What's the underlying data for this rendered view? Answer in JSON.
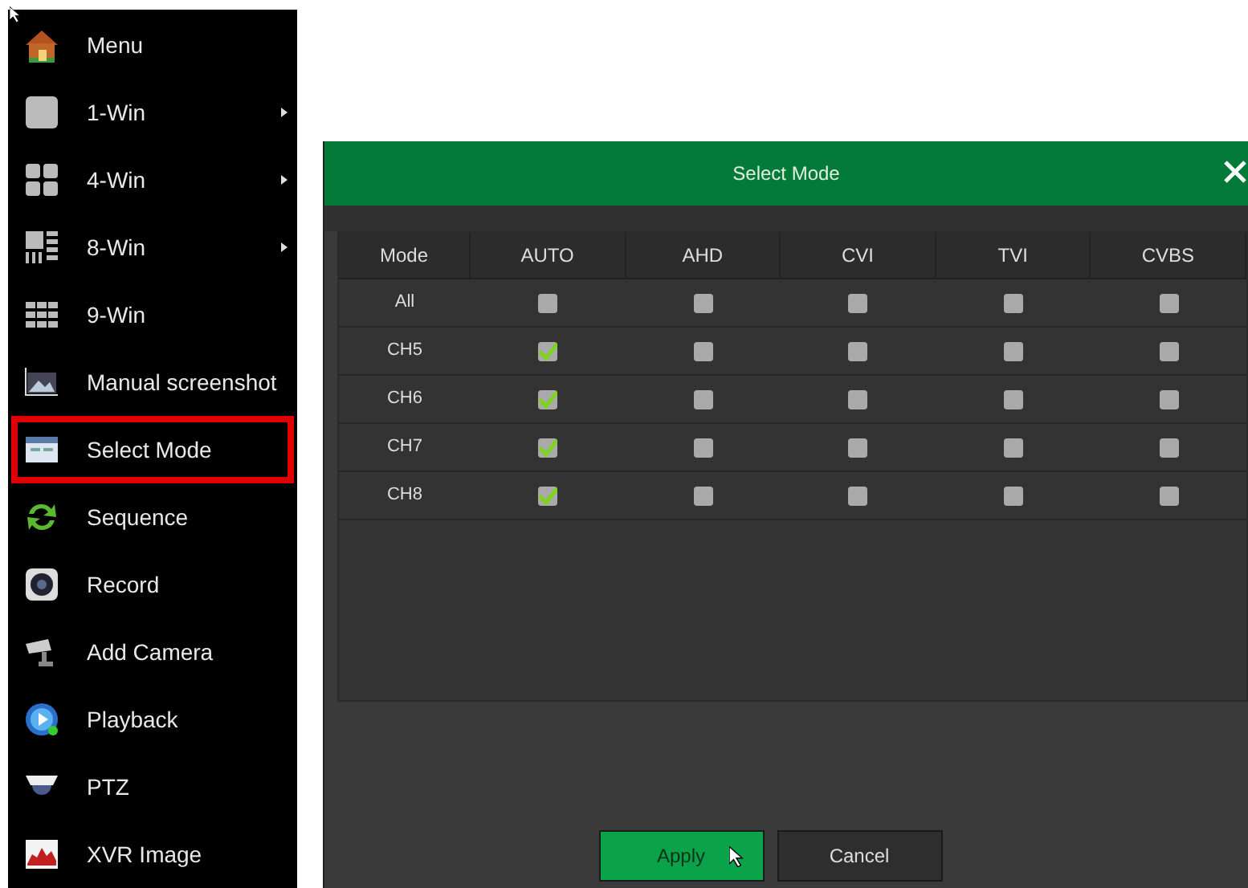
{
  "menu": {
    "items": [
      {
        "label": "Menu",
        "selected": false,
        "has_submenu": false
      },
      {
        "label": "1-Win",
        "selected": false,
        "has_submenu": true
      },
      {
        "label": "4-Win",
        "selected": false,
        "has_submenu": true
      },
      {
        "label": "8-Win",
        "selected": false,
        "has_submenu": true
      },
      {
        "label": "9-Win",
        "selected": false,
        "has_submenu": false
      },
      {
        "label": "Manual screenshot",
        "selected": false,
        "has_submenu": false
      },
      {
        "label": "Select Mode",
        "selected": true,
        "has_submenu": false
      },
      {
        "label": "Sequence",
        "selected": false,
        "has_submenu": false
      },
      {
        "label": "Record",
        "selected": false,
        "has_submenu": false
      },
      {
        "label": "Add Camera",
        "selected": false,
        "has_submenu": false
      },
      {
        "label": "Playback",
        "selected": false,
        "has_submenu": false
      },
      {
        "label": "PTZ",
        "selected": false,
        "has_submenu": false
      },
      {
        "label": "XVR Image",
        "selected": false,
        "has_submenu": false
      }
    ]
  },
  "dialog": {
    "title": "Select Mode",
    "table": {
      "columns": [
        "Mode",
        "AUTO",
        "AHD",
        "CVI",
        "TVI",
        "CVBS"
      ],
      "rows": [
        {
          "label": "All",
          "cells": [
            {
              "checked": false
            },
            {
              "checked": false
            },
            {
              "checked": false
            },
            {
              "checked": false
            },
            {
              "checked": false
            }
          ]
        },
        {
          "label": "CH5",
          "cells": [
            {
              "checked": true
            },
            {
              "checked": false
            },
            {
              "checked": false
            },
            {
              "checked": false
            },
            {
              "checked": false
            }
          ]
        },
        {
          "label": "CH6",
          "cells": [
            {
              "checked": true
            },
            {
              "checked": false
            },
            {
              "checked": false
            },
            {
              "checked": false
            },
            {
              "checked": false
            }
          ]
        },
        {
          "label": "CH7",
          "cells": [
            {
              "checked": true
            },
            {
              "checked": false
            },
            {
              "checked": false
            },
            {
              "checked": false
            },
            {
              "checked": false
            }
          ]
        },
        {
          "label": "CH8",
          "cells": [
            {
              "checked": true
            },
            {
              "checked": false
            },
            {
              "checked": false
            },
            {
              "checked": false
            },
            {
              "checked": false
            }
          ]
        }
      ]
    },
    "buttons": [
      {
        "label": "Apply",
        "kind": "primary"
      },
      {
        "label": "Cancel",
        "kind": "secondary"
      }
    ]
  }
}
